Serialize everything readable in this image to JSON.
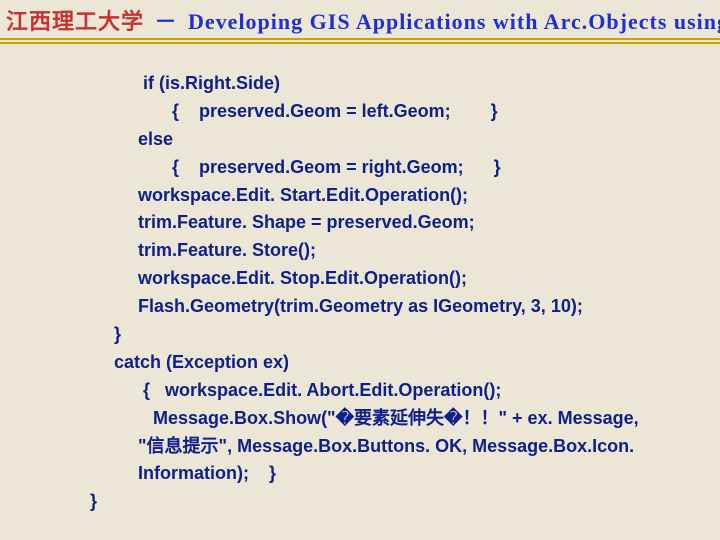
{
  "header": {
    "university": "江西理工大学",
    "separator": "－",
    "course": "Developing GIS Applications with Arc.Objects using C#. NE"
  },
  "code": {
    "l1": " if (is.Right.Side)",
    "l2": "  {    preserved.Geom = left.Geom;        }",
    "l3": "else",
    "l4": "  {    preserved.Geom = right.Geom;      }",
    "l5": "workspace.Edit. Start.Edit.Operation();",
    "l6": "trim.Feature. Shape = preserved.Geom;",
    "l7": "trim.Feature. Store();",
    "l8": "workspace.Edit. Stop.Edit.Operation();",
    "l9": "Flash.Geometry(trim.Geometry as IGeometry, 3, 10);",
    "l10": "}",
    "l11": "catch (Exception ex)",
    "l12": " {   workspace.Edit. Abort.Edit.Operation();",
    "l13": "   Message.Box.Show(\"�要素延伸失�！！\" + ex. Message, \"信息提示\", Message.Box.Buttons. OK, Message.Box.Icon. Information);    }",
    "l14": "}"
  }
}
